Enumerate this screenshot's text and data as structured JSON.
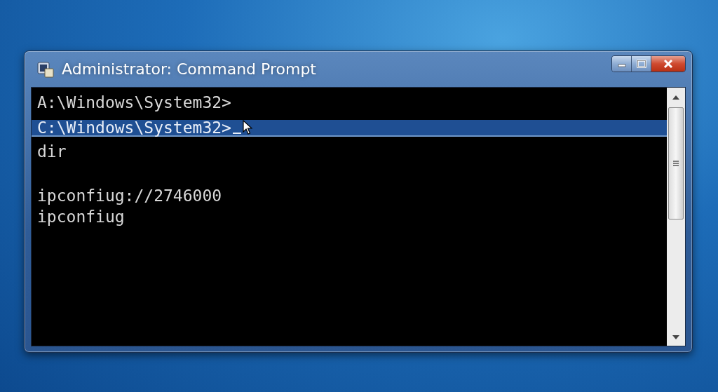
{
  "window": {
    "title": "Administrator: Command Prompt"
  },
  "console": {
    "lines": [
      {
        "kind": "text",
        "text": "A:\\Windows\\System32>",
        "selected": false,
        "cursor": false
      },
      {
        "kind": "text",
        "text": "C:\\Windows\\System32>",
        "selected": true,
        "cursor": true
      },
      {
        "kind": "text",
        "text": "dir",
        "selected": false,
        "cursor": false
      },
      {
        "kind": "blank"
      },
      {
        "kind": "text",
        "text": "ipconfiug://2746000",
        "selected": false,
        "cursor": false
      },
      {
        "kind": "text",
        "text": "ipconfiug",
        "selected": false,
        "cursor": false
      }
    ]
  }
}
